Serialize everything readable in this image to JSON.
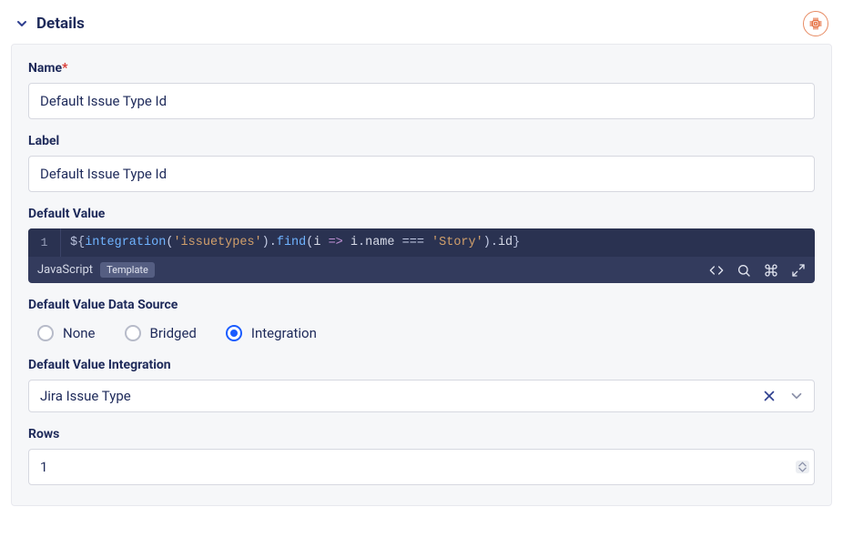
{
  "header": {
    "title": "Details"
  },
  "fields": {
    "name": {
      "label": "Name",
      "required_marker": "*",
      "value": "Default Issue Type Id"
    },
    "label": {
      "label": "Label",
      "value": "Default Issue Type Id"
    },
    "defaultValue": {
      "label": "Default Value",
      "lineNumber": "1",
      "code": {
        "t1": "${",
        "t2": "integration",
        "t3": "(",
        "t4": "'issuetypes'",
        "t5": ").",
        "t6": "find",
        "t7": "(",
        "t8": "i",
        "t9": " => ",
        "t10": "i",
        "t11": ".",
        "t12": "name",
        "t13": " === ",
        "t14": "'Story'",
        "t15": ").",
        "t16": "id",
        "t17": "}"
      },
      "language": "JavaScript",
      "badge": "Template"
    },
    "dataSource": {
      "label": "Default Value Data Source",
      "options": {
        "none": "None",
        "bridged": "Bridged",
        "integration": "Integration"
      },
      "selected": "integration"
    },
    "integration": {
      "label": "Default Value Integration",
      "value": "Jira Issue Type"
    },
    "rows": {
      "label": "Rows",
      "value": "1"
    }
  }
}
